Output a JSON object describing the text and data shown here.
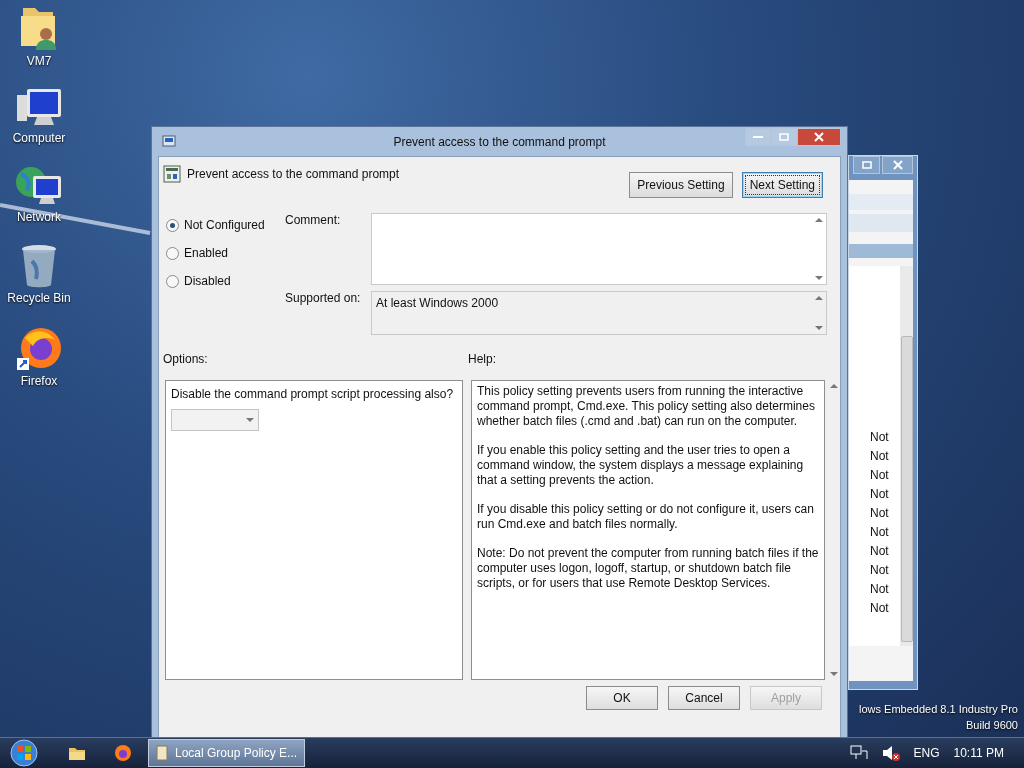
{
  "desktop": {
    "icons": [
      {
        "label": "VM7",
        "kind": "folder"
      },
      {
        "label": "Computer",
        "kind": "computer"
      },
      {
        "label": "Network",
        "kind": "network"
      },
      {
        "label": "Recycle Bin",
        "kind": "recycle"
      },
      {
        "label": "Firefox",
        "kind": "firefox"
      }
    ],
    "os_text": [
      "lows Embedded 8.1 Industry Pro",
      "Build 9600"
    ]
  },
  "background_window": {
    "rows": [
      "Not",
      "Not",
      "Not",
      "Not",
      "Not",
      "Not",
      "Not",
      "Not",
      "Not",
      "Not"
    ]
  },
  "dialog": {
    "title": "Prevent access to the command prompt",
    "setting_name": "Prevent access to the command prompt",
    "nav_buttons": [
      {
        "label": "Previous Setting",
        "focused": false
      },
      {
        "label": "Next Setting",
        "focused": true
      }
    ],
    "states": [
      {
        "label": "Not Configured",
        "selected": true
      },
      {
        "label": "Enabled",
        "selected": false
      },
      {
        "label": "Disabled",
        "selected": false
      }
    ],
    "comment_label": "Comment:",
    "supported_label": "Supported on:",
    "supported_value": "At least Windows 2000",
    "options_label": "Options:",
    "help_label": "Help:",
    "option_prompt": "Disable the command prompt script processing also?",
    "help": [
      "This policy setting prevents users from running the interactive command prompt, Cmd.exe.  This policy setting also determines whether batch files (.cmd and .bat) can run on the computer.",
      "If you enable this policy setting and the user tries to open a command window, the system displays a message explaining that a setting prevents the action.",
      "If you disable this policy setting or do not configure it, users can run Cmd.exe and batch files normally.",
      "Note: Do not prevent the computer from running batch files if the computer uses logon, logoff, startup, or shutdown batch file scripts, or for users that use Remote Desktop Services."
    ],
    "buttons": [
      {
        "label": "OK",
        "disabled": false
      },
      {
        "label": "Cancel",
        "disabled": false
      },
      {
        "label": "Apply",
        "disabled": true
      }
    ]
  },
  "taskbar": {
    "task": "Local Group Policy E...",
    "language": "ENG",
    "time": "10:11 PM"
  }
}
